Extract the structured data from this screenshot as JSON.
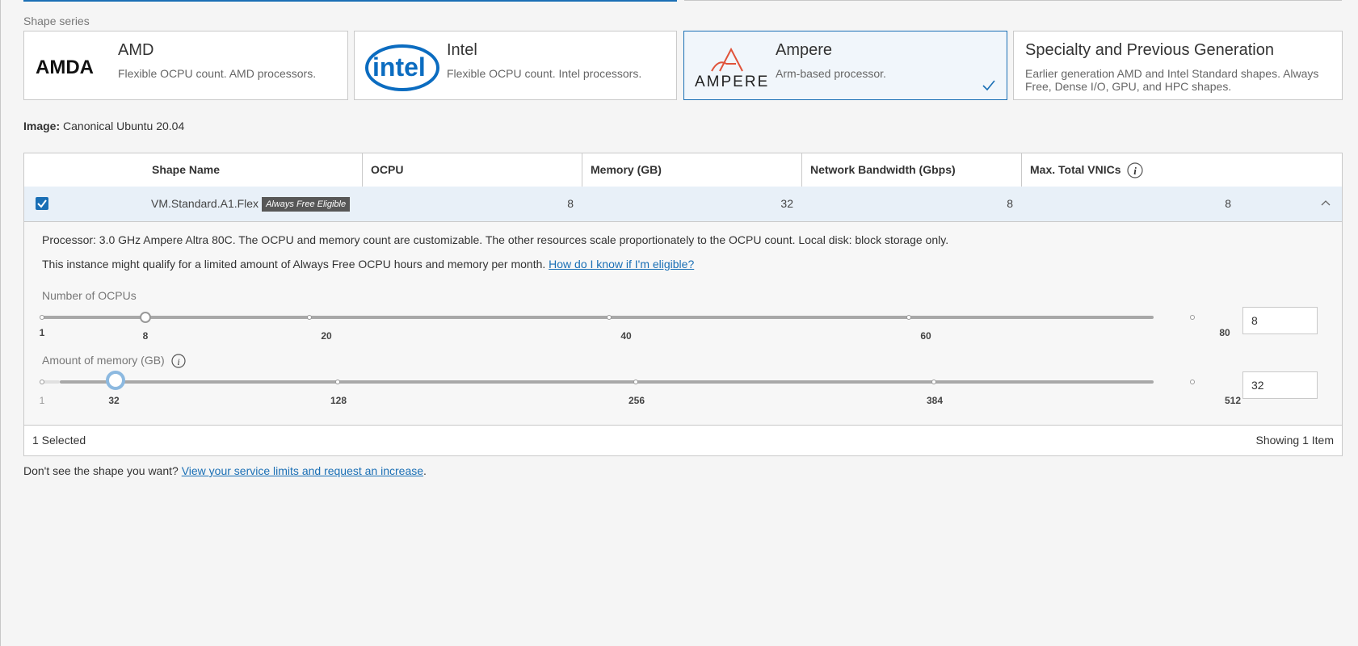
{
  "shape_series_label": "Shape series",
  "cards": [
    {
      "logo": "AMDA",
      "title": "AMD",
      "desc": "Flexible OCPU count. AMD processors."
    },
    {
      "logo": "intel",
      "title": "Intel",
      "desc": "Flexible OCPU count. Intel processors."
    },
    {
      "logo": "AMPERE",
      "title": "Ampere",
      "desc": "Arm-based processor.",
      "selected": true
    },
    {
      "title": "Specialty and Previous Generation",
      "desc": "Earlier generation AMD and Intel Standard shapes. Always Free, Dense I/O, GPU, and HPC shapes."
    }
  ],
  "image": {
    "label": "Image:",
    "value": "Canonical Ubuntu 20.04"
  },
  "table": {
    "headers": [
      "Shape Name",
      "OCPU",
      "Memory (GB)",
      "Network Bandwidth (Gbps)",
      "Max. Total VNICs"
    ],
    "row": {
      "name": "VM.Standard.A1.Flex",
      "badge": "Always Free Eligible",
      "ocpu": "8",
      "memory": "32",
      "bandwidth": "8",
      "vnics": "8"
    },
    "details": {
      "processor": "Processor: 3.0 GHz Ampere Altra 80C. The OCPU and memory count are customizable. The other resources scale proportionately to the OCPU count. Local disk: block storage only.",
      "free_text": "This instance might qualify for a limited amount of Always Free OCPU hours and memory per month.",
      "free_link": "How do I know if I'm eligible?",
      "ocpu_slider": {
        "label": "Number of OCPUs",
        "value": "8",
        "ticks": [
          "1",
          "8",
          "20",
          "40",
          "60",
          "80"
        ]
      },
      "mem_slider": {
        "label": "Amount of memory (GB)",
        "value": "32",
        "ticks": [
          "1",
          "32",
          "128",
          "256",
          "384",
          "512"
        ]
      }
    },
    "footer": {
      "selected": "1 Selected",
      "showing": "Showing 1 Item"
    }
  },
  "bottom": {
    "text": "Don't see the shape you want?",
    "link": "View your service limits and request an increase",
    "end": "."
  },
  "colors": {
    "accent": "#1a6fb5",
    "intel": "#0b6cc0",
    "ampere": "#e0533a"
  }
}
